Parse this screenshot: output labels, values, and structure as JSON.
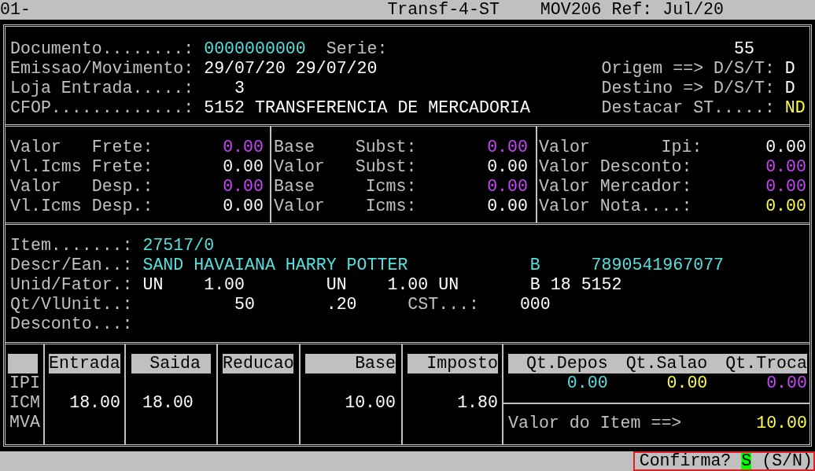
{
  "title_bar": {
    "session": "01-",
    "program": "Transf-4-ST",
    "module": "MOV206 Ref: Jul/20"
  },
  "header_left": [
    {
      "label": "Documento........:",
      "value": "0000000000",
      "color": "#55e0e0"
    },
    {
      "label": "Emissao/Movimento:",
      "value": "29/07/20 29/07/20",
      "color": "#ffffff"
    },
    {
      "label": "Loja Entrada.....:",
      "value": "3",
      "color": "#ffffff"
    },
    {
      "label": "CFOP.............:",
      "value": "5152 TRANSFERENCIA DE MERCADORIA",
      "color": "#ffffff"
    }
  ],
  "header_right": [
    {
      "label": "Serie:",
      "value": "55",
      "color": "#ffffff"
    },
    {
      "label": "Origem ==> D/S/T:",
      "value": "D",
      "color": "#ffffff"
    },
    {
      "label": "Destino => D/S/T:",
      "value": "D",
      "color": "#ffffff"
    },
    {
      "label": "Destacar ST.....:",
      "value": "ND",
      "color": "#ffff40"
    }
  ],
  "totals": [
    [
      {
        "label": "Valor   Frete:",
        "value": "0.00",
        "color": "#cc44ff"
      },
      {
        "label": "Vl.Icms Frete:",
        "value": "0.00",
        "color": "#ffffff"
      },
      {
        "label": "Valor   Desp.:",
        "value": "0.00",
        "color": "#cc44ff"
      },
      {
        "label": "Vl.Icms Desp.:",
        "value": "0.00",
        "color": "#ffffff"
      }
    ],
    [
      {
        "label": "Base    Subst:",
        "value": "0.00",
        "color": "#cc44ff"
      },
      {
        "label": "Valor   Subst:",
        "value": "0.00",
        "color": "#ffffff"
      },
      {
        "label": "Base     Icms:",
        "value": "0.00",
        "color": "#cc44ff"
      },
      {
        "label": "Valor    Icms:",
        "value": "0.00",
        "color": "#ffffff"
      }
    ],
    [
      {
        "label": "Valor       Ipi:",
        "value": "0.00",
        "color": "#ffffff"
      },
      {
        "label": "Valor Desconto:",
        "value": "0.00",
        "color": "#cc44ff"
      },
      {
        "label": "Valor Mercador:",
        "value": "0.00",
        "color": "#cc44ff"
      },
      {
        "label": "Valor Nota....:",
        "value": "0.00",
        "color": "#ffff40"
      }
    ]
  ],
  "item": [
    {
      "label": "Item.......:",
      "values": [
        {
          "text": "27517/0",
          "color": "#55e0e0"
        }
      ]
    },
    {
      "label": "Descr/Ean..:",
      "values": [
        {
          "text": "SAND HAVAIANA HARRY POTTER",
          "color": "#55e0e0"
        },
        {
          "text": "B",
          "color": "#55e0e0"
        },
        {
          "text": "7890541967077",
          "color": "#55e0e0"
        }
      ]
    },
    {
      "label": "Unid/Fator.:",
      "values": [
        {
          "text": "UN",
          "color": "#ffffff"
        },
        {
          "text": "1.00",
          "color": "#ffffff"
        },
        {
          "text": "UN",
          "color": "#ffffff"
        },
        {
          "text": "1.00",
          "color": "#ffffff"
        },
        {
          "text": "UN",
          "color": "#ffffff"
        },
        {
          "text": "B 18 5152",
          "color": "#ffffff"
        }
      ]
    },
    {
      "label": "Qt/VlUnit..:",
      "values": [
        {
          "text": "50",
          "color": "#ffffff"
        },
        {
          "text": ".20",
          "color": "#ffffff"
        },
        {
          "text": "CST...:",
          "color": "#c0c0c0"
        },
        {
          "text": "000",
          "color": "#ffffff"
        }
      ]
    },
    {
      "label": "Desconto...:"
    }
  ],
  "tax_table": {
    "columns": [
      "Entrada",
      "Saida",
      "Reducao",
      "Base",
      "Imposto"
    ],
    "rows": [
      {
        "label": "IPI"
      },
      {
        "label": "ICM",
        "cells": [
          "18.00",
          "18.00",
          null,
          "10.00",
          "1.80"
        ]
      },
      {
        "label": "MVA"
      }
    ]
  },
  "stock": {
    "columns": [
      "Qt.Depos",
      "Qt.Salao",
      "Qt.Troca"
    ],
    "values": [
      {
        "text": "0.00",
        "color": "#55e0e0"
      },
      {
        "text": "0.00",
        "color": "#ffff40"
      },
      {
        "text": "0.00",
        "color": "#cc44ff"
      }
    ]
  },
  "item_total": {
    "label": "Valor do Item ==>",
    "value": "10.00",
    "color": "#ffff40"
  },
  "prompt": {
    "question": "Confirma?",
    "answer": "S",
    "options": "(S/N)"
  }
}
